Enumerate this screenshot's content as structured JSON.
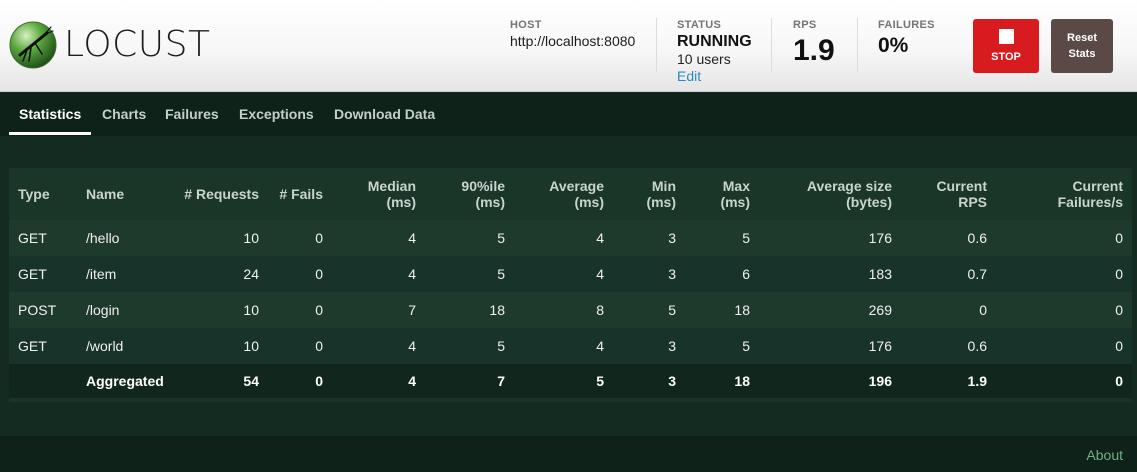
{
  "header": {
    "logo_text": "LOCUST",
    "host": {
      "label": "HOST",
      "value": "http://localhost:8080"
    },
    "status": {
      "label": "STATUS",
      "value": "RUNNING",
      "users": "10 users",
      "edit": "Edit"
    },
    "rps": {
      "label": "RPS",
      "value": "1.9"
    },
    "failures": {
      "label": "FAILURES",
      "value": "0%"
    },
    "stop_label": "STOP",
    "reset_label": "Reset Stats"
  },
  "nav": {
    "tabs": [
      {
        "label": "Statistics",
        "active": true
      },
      {
        "label": "Charts"
      },
      {
        "label": "Failures"
      },
      {
        "label": "Exceptions"
      },
      {
        "label": "Download Data"
      }
    ]
  },
  "table": {
    "columns": [
      "Type",
      "Name",
      "# Requests",
      "# Fails",
      "Median\n(ms)",
      "90%ile\n(ms)",
      "Average\n(ms)",
      "Min\n(ms)",
      "Max\n(ms)",
      "Average size\n(bytes)",
      "Current\nRPS",
      "Current\nFailures/s"
    ],
    "rows": [
      [
        "GET",
        "/hello",
        "10",
        "0",
        "4",
        "5",
        "4",
        "3",
        "5",
        "176",
        "0.6",
        "0"
      ],
      [
        "GET",
        "/item",
        "24",
        "0",
        "4",
        "5",
        "4",
        "3",
        "6",
        "183",
        "0.7",
        "0"
      ],
      [
        "POST",
        "/login",
        "10",
        "0",
        "7",
        "18",
        "8",
        "5",
        "18",
        "269",
        "0",
        "0"
      ],
      [
        "GET",
        "/world",
        "10",
        "0",
        "4",
        "5",
        "4",
        "3",
        "5",
        "176",
        "0.6",
        "0"
      ]
    ],
    "aggregated": [
      "",
      "Aggregated",
      "54",
      "0",
      "4",
      "7",
      "5",
      "3",
      "18",
      "196",
      "1.9",
      "0"
    ]
  },
  "footer": {
    "about": "About"
  },
  "colors": {
    "stop": "#d71b1e",
    "reset": "#5b4946",
    "background": "#132b21",
    "link": "#2a8bc3"
  }
}
